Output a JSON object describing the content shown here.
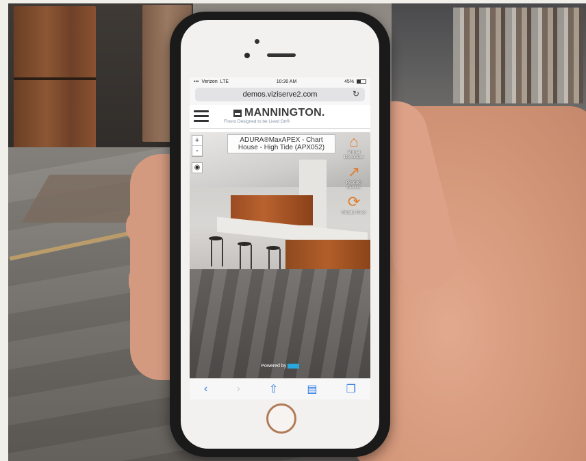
{
  "phone": {
    "carrier": "Verizon",
    "network": "LTE",
    "time": "10:30 AM",
    "battery": "45%",
    "url": "demos.viziserve2.com"
  },
  "site": {
    "logo_text": "MANNINGTON.",
    "tagline": "Floors Designed to be Lived On®"
  },
  "viewer": {
    "product_name": "ADURA®MaxAPEX - Chart House - High Tide (APX052)",
    "zoom_in": "+",
    "zoom_out": "-",
    "tools": [
      {
        "label": "Virtual Decorator",
        "icon": "home-icon"
      },
      {
        "label": "Product Details",
        "icon": "external-link-icon"
      },
      {
        "label": "Rotate Floor",
        "icon": "rotate-icon"
      }
    ],
    "powered_by": "Powered by"
  },
  "colors": {
    "accent": "#e07b2c",
    "link_blue": "#2a7ae2"
  }
}
